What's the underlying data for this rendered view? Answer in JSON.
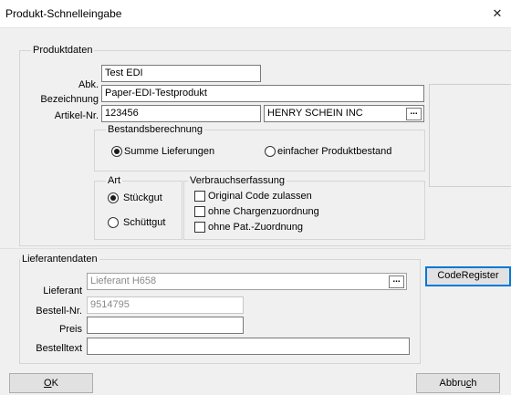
{
  "window": {
    "title": "Produkt-Schnelleingabe"
  },
  "produktdaten": {
    "group_title": "Produktdaten",
    "abk": {
      "label": "Abk.",
      "value": "Test EDI"
    },
    "bezeichnung": {
      "label": "Bezeichnung",
      "value": "Paper-EDI-Testprodukt"
    },
    "artikel_nr": {
      "label": "Artikel-Nr.",
      "value": "123456",
      "supplier": "HENRY SCHEIN INC",
      "lookup": "..."
    },
    "bestandsberechnung": {
      "title": "Bestandsberechnung",
      "options": [
        {
          "label": "Summe Lieferungen",
          "selected": true
        },
        {
          "label": "einfacher Produktbestand",
          "selected": false
        }
      ]
    },
    "art": {
      "title": "Art",
      "options": [
        {
          "label": "Stückgut",
          "selected": true
        },
        {
          "label": "Schüttgut",
          "selected": false
        }
      ]
    },
    "verbrauchserfassung": {
      "title": "Verbrauchserfassung",
      "options": [
        {
          "label": "Original Code zulassen",
          "checked": false
        },
        {
          "label": "ohne Chargenzuordnung",
          "checked": false
        },
        {
          "label": "ohne Pat.-Zuordnung",
          "checked": false
        }
      ]
    }
  },
  "lieferantendaten": {
    "group_title": "Lieferantendaten",
    "lieferant": {
      "label": "Lieferant",
      "value": "Lieferant H658",
      "lookup": "..."
    },
    "bestell_nr": {
      "label": "Bestell-Nr.",
      "value": "9514795"
    },
    "preis": {
      "label": "Preis",
      "value": ""
    },
    "bestelltext": {
      "label": "Bestelltext",
      "value": ""
    }
  },
  "buttons": {
    "code_register": "CodeRegister",
    "ok": "OK",
    "ok_mnemonic": "O",
    "ok_rest": "K",
    "abbruch": "Abbruch",
    "abbruch_pre": "Abbru",
    "abbruch_mnemonic": "c",
    "abbruch_post": "h"
  },
  "colors": {
    "window_bg": "#f0f0f0",
    "focus_border": "#0078d7",
    "disabled_text": "#8a8a8a"
  }
}
